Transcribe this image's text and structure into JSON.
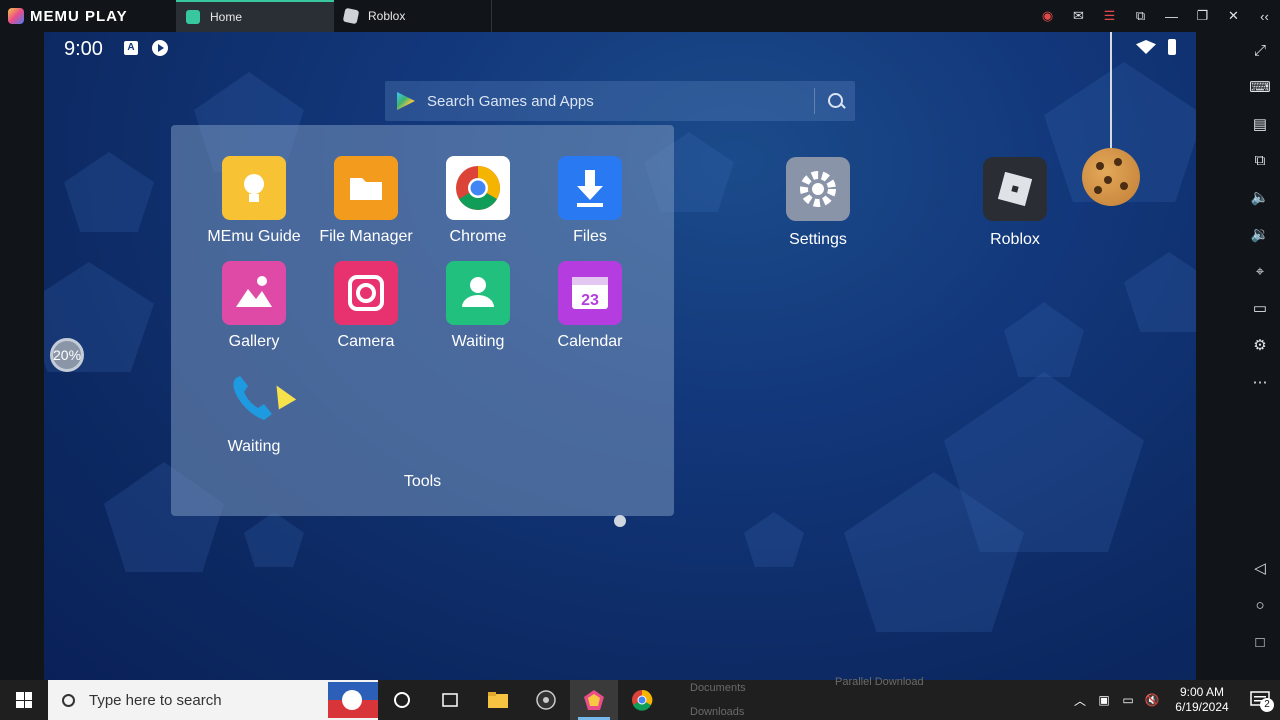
{
  "titlebar": {
    "brand": "MEMU PLAY",
    "tabs": [
      {
        "label": "Home"
      },
      {
        "label": "Roblox"
      }
    ]
  },
  "android": {
    "clock": "9:00",
    "status_a": "A",
    "search_placeholder": "Search Games and Apps",
    "folder": {
      "name": "Tools",
      "apps": [
        {
          "label": "MEmu Guide",
          "color": "#f7c234"
        },
        {
          "label": "File Manager",
          "color": "#f39b1c"
        },
        {
          "label": "Chrome",
          "color": "#ffffff"
        },
        {
          "label": "Files",
          "color": "#2979f2"
        },
        {
          "label": "Gallery",
          "color": "#e04aa7"
        },
        {
          "label": "Camera",
          "color": "#e8316f"
        },
        {
          "label": "Waiting",
          "color": "#22c07e"
        },
        {
          "label": "Calendar",
          "color": "#b53de0"
        },
        {
          "label": "Waiting",
          "color": "#1e9be0"
        }
      ]
    },
    "desktop_apps": [
      {
        "label": "Settings",
        "color": "#8a94a8"
      },
      {
        "label": "Roblox",
        "color": "#2a2d33"
      }
    ],
    "progress_label": "20%",
    "calendar_number": "23"
  },
  "taskbar": {
    "search_placeholder": "Type here to search",
    "ghost_left_1": "Documents",
    "ghost_left_2": "Downloads",
    "ghost_right": "Parallel Download",
    "time": "9:00 AM",
    "date": "6/19/2024",
    "notification_count": "2"
  }
}
